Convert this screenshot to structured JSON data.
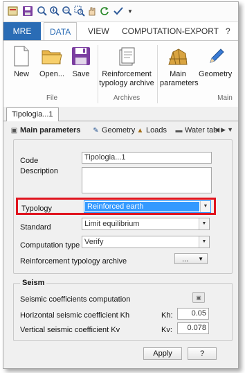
{
  "qat": {
    "icons": [
      "app-icon",
      "save-icon",
      "zoom-icon",
      "zoom-in-icon",
      "zoom-out-icon",
      "zoom-window-icon",
      "pan-icon",
      "refresh-icon",
      "check-icon",
      "dropdown-arrow-icon"
    ]
  },
  "ribbon": {
    "tabs": [
      "MRE",
      "DATA",
      "VIEW",
      "COMPUTATION-EXPORT"
    ],
    "help": "?",
    "file": {
      "new": "New",
      "open": "Open...",
      "save": "Save",
      "group": "File"
    },
    "archives": {
      "reinforcement_line1": "Reinforcement",
      "reinforcement_line2": "typology archive",
      "group": "Archives"
    },
    "main": {
      "main_params_line1": "Main",
      "main_params_line2": "parameters",
      "geometry": "Geometry",
      "group": "Main"
    }
  },
  "doc_tab": "Tipologia...1",
  "panel_tabs": [
    "Main parameters",
    "Geometry",
    "Loads",
    "Water tab"
  ],
  "form": {
    "code_label": "Code",
    "code_value": "Tipologia...1",
    "description_label": "Description",
    "description_value": "",
    "typology_label": "Typology",
    "typology_value": "Reinforced earth",
    "standard_label": "Standard",
    "standard_value": "Limit equilibrium",
    "computation_type_label": "Computation type",
    "computation_type_value": "Verify",
    "archive_label": "Reinforcement typology archive",
    "archive_button": "..."
  },
  "seismic": {
    "title": "Seism",
    "computation_label": "Seismic coefficients computation",
    "kh_label": "Horizontal seismic coefficient Kh",
    "kh_short": "Kh:",
    "kh_value": "0.05",
    "kv_label": "Vertical seismic coefficient Kv",
    "kv_short": "Kv:",
    "kv_value": "0.078"
  },
  "buttons": {
    "apply": "Apply",
    "help": "?"
  },
  "colors": {
    "accent": "#2a6cb5",
    "highlight_border": "#e0141e",
    "selection": "#3399ff"
  }
}
